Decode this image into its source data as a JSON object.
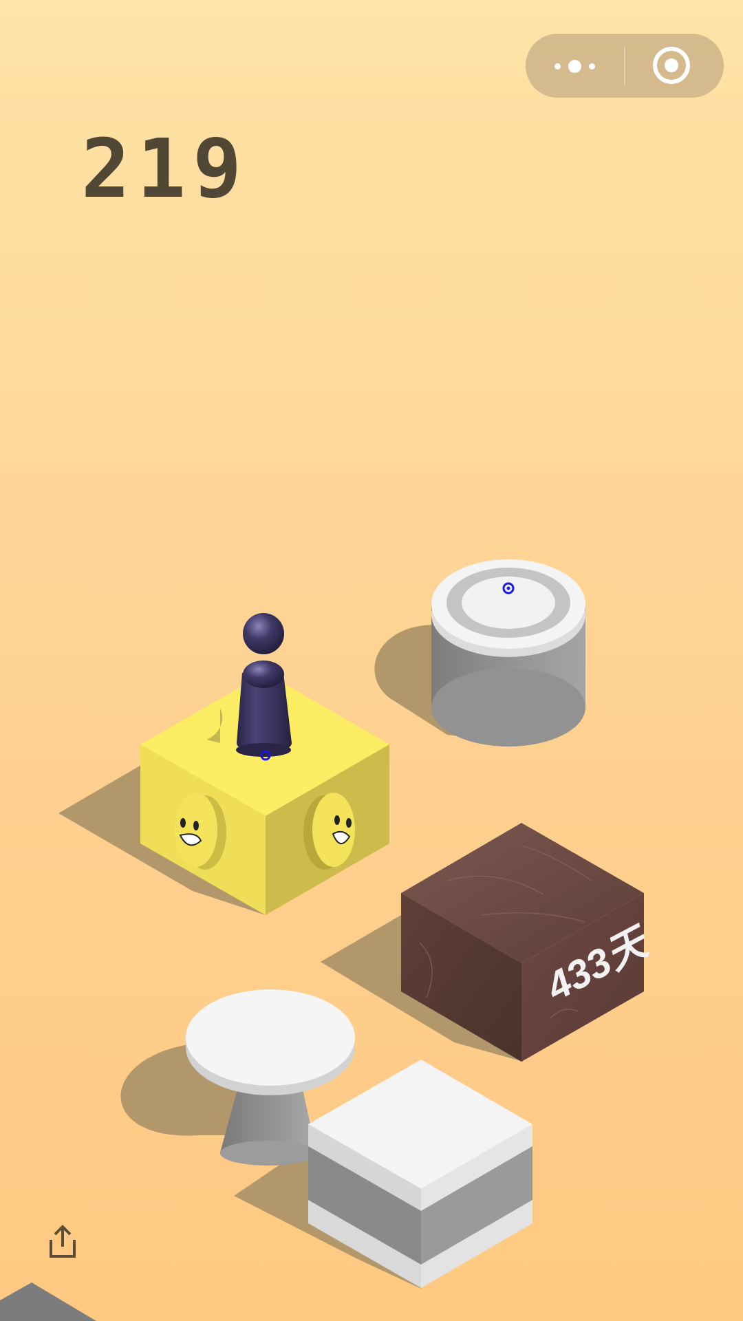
{
  "game": {
    "score": "219",
    "platform_label": "433天"
  },
  "top_bar": {
    "more_icon": "more-dots-icon",
    "close_icon": "target-ring-icon"
  },
  "bottom_bar": {
    "share_icon": "share-icon"
  },
  "colors": {
    "background_top": "#ffe3a7",
    "background_bottom": "#fec982",
    "score_text": "#514735",
    "player": "#37325a",
    "yellow_box": "#fbe864",
    "white_platform": "#f4f4f4",
    "gray_platform": "#9b9b9b",
    "brown_box": "#6e4a42",
    "capsule": "#cbb088",
    "target_marker": "#1717e6"
  }
}
